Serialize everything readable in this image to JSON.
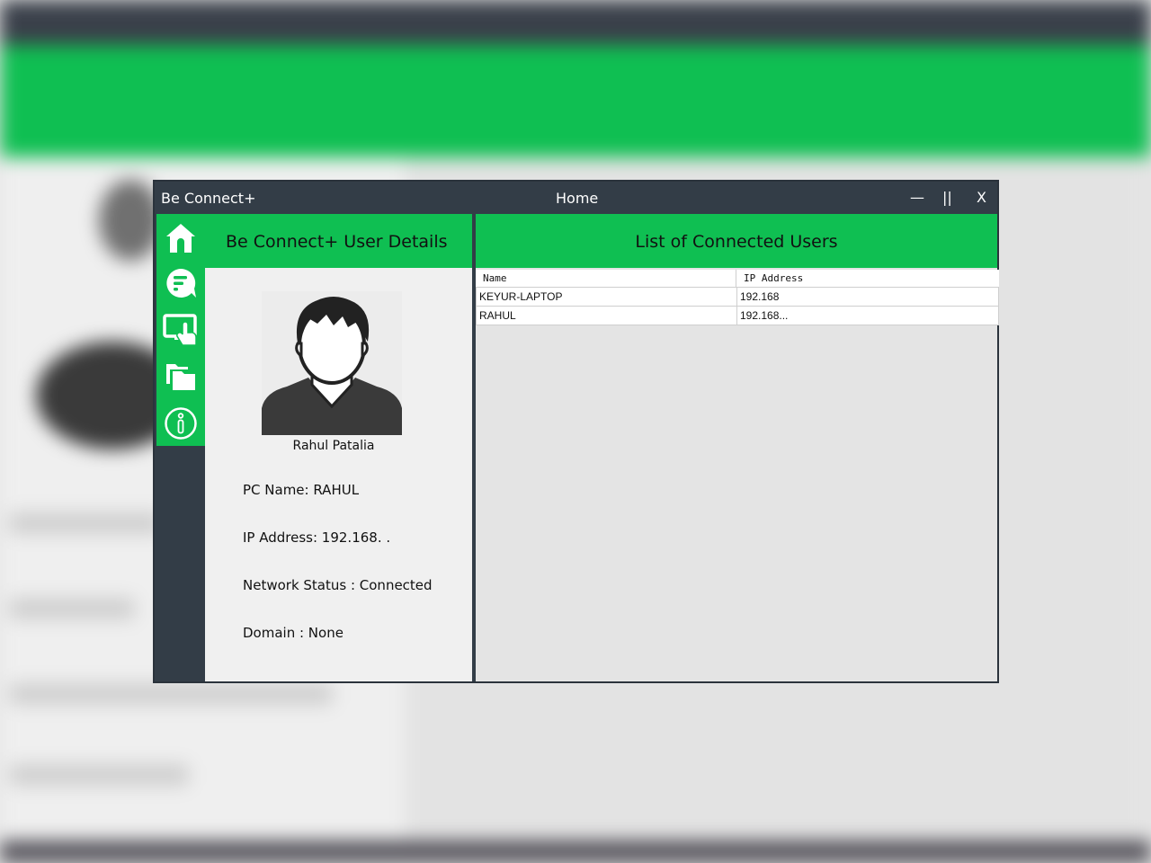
{
  "window": {
    "app_title": "Be Connect+",
    "page_title": "Home",
    "minimize_label": "—",
    "maximize_label": "||",
    "close_label": "X"
  },
  "sidebar": {
    "items": [
      {
        "name": "home",
        "icon": "home-icon"
      },
      {
        "name": "chat",
        "icon": "chat-icon"
      },
      {
        "name": "screen-share",
        "icon": "screen-touch-icon"
      },
      {
        "name": "files",
        "icon": "folders-icon"
      },
      {
        "name": "about",
        "icon": "info-icon"
      }
    ]
  },
  "details": {
    "title": "Be Connect+ User Details",
    "avatar_icon": "user-avatar-icon",
    "user_name": "Rahul Patalia",
    "pc_name": "PC Name: RAHUL",
    "ip_address": "IP Address: 192.168.  .",
    "network_status": "Network Status : Connected",
    "domain": "Domain : None"
  },
  "users": {
    "title": "List of Connected Users",
    "columns": [
      "Name",
      "IP Address"
    ],
    "rows": [
      {
        "name": "KEYUR-LAPTOP",
        "ip": "192.168"
      },
      {
        "name": "RAHUL",
        "ip": "192.168..."
      }
    ]
  },
  "colors": {
    "accent": "#0fbf52",
    "sidebar_dark": "#333d47",
    "panel_light": "#f0f0f0"
  }
}
